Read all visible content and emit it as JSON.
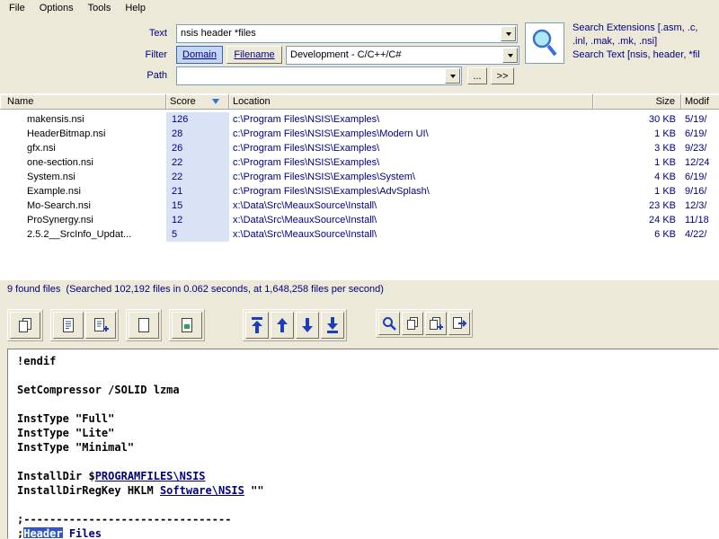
{
  "colors": {
    "window_bg": "#ece9d8",
    "accent": "#316ac5",
    "navy_text": "#000080",
    "score_cell_bg": "#d9e3f5",
    "selection_bg": "#3058c5"
  },
  "menu": {
    "items": [
      "File",
      "Options",
      "Tools",
      "Help"
    ]
  },
  "search": {
    "text_label": "Text",
    "text_value": "nsis header *files",
    "filter_label": "Filter",
    "domain_toggle": "Domain",
    "filename_toggle": "Filename",
    "category_value": "Development - C/C++/C#",
    "path_label": "Path",
    "path_value": "",
    "browse_label": "...",
    "more_label": ">>",
    "info_lines": [
      "Search Extensions [.asm, .c,",
      ".inl, .mak, .mk, .nsi]",
      "Search Text [nsis, header, *fil"
    ]
  },
  "results": {
    "columns": [
      "Name",
      "Score",
      "Location",
      "Size",
      "Modif"
    ],
    "sort_column": "Score",
    "sort_direction": "descending",
    "rows": [
      {
        "name": "makensis.nsi",
        "score": "126",
        "location": "c:\\Program Files\\NSIS\\Examples\\",
        "size": "30 KB",
        "modified": "5/19/"
      },
      {
        "name": "HeaderBitmap.nsi",
        "score": "28",
        "location": "c:\\Program Files\\NSIS\\Examples\\Modern UI\\",
        "size": "1 KB",
        "modified": "6/19/"
      },
      {
        "name": "gfx.nsi",
        "score": "26",
        "location": "c:\\Program Files\\NSIS\\Examples\\",
        "size": "3 KB",
        "modified": "9/23/"
      },
      {
        "name": "one-section.nsi",
        "score": "22",
        "location": "c:\\Program Files\\NSIS\\Examples\\",
        "size": "1 KB",
        "modified": "12/24"
      },
      {
        "name": "System.nsi",
        "score": "22",
        "location": "c:\\Program Files\\NSIS\\Examples\\System\\",
        "size": "4 KB",
        "modified": "6/19/"
      },
      {
        "name": "Example.nsi",
        "score": "21",
        "location": "c:\\Program Files\\NSIS\\Examples\\AdvSplash\\",
        "size": "1 KB",
        "modified": "9/16/"
      },
      {
        "name": "Mo-Search.nsi",
        "score": "15",
        "location": "x:\\Data\\Src\\MeauxSource\\Install\\",
        "size": "23 KB",
        "modified": "12/3/"
      },
      {
        "name": "ProSynergy.nsi",
        "score": "12",
        "location": "x:\\Data\\Src\\MeauxSource\\Install\\",
        "size": "24 KB",
        "modified": "11/18"
      },
      {
        "name": "2.5.2__SrcInfo_Updat...",
        "score": "5",
        "location": "x:\\Data\\Src\\MeauxSource\\Install\\",
        "size": "6 KB",
        "modified": "4/22/"
      }
    ]
  },
  "status": {
    "text": "9 found files  (Searched 102,192 files in 0.062 seconds, at 1,648,258 files per second)"
  },
  "preview": {
    "toolbar_groups": [
      [
        "copy-icon"
      ],
      [
        "doc-lines-icon",
        "doc-add-icon"
      ],
      [
        "doc-blank-icon"
      ],
      [
        "doc-image-icon"
      ],
      [
        "first-match-icon",
        "prev-match-icon",
        "next-match-icon",
        "last-match-icon"
      ],
      [
        "find-icon",
        "copy-small-icon",
        "copy-add-icon",
        "export-icon"
      ]
    ],
    "lines": [
      [
        {
          "t": "!endif"
        }
      ],
      [],
      [
        {
          "t": "SetCompressor /SOLID lzma"
        }
      ],
      [],
      [
        {
          "t": "InstType \"Full\""
        }
      ],
      [
        {
          "t": "InstType \"Lite\""
        }
      ],
      [
        {
          "t": "InstType \"Minimal\""
        }
      ],
      [],
      [
        {
          "t": "InstallDir $"
        },
        {
          "t": "PROGRAMFILES\\NSIS",
          "match": true
        }
      ],
      [
        {
          "t": "InstallDirRegKey HKLM "
        },
        {
          "t": "Software\\NSIS",
          "match": true
        },
        {
          "t": " \"\""
        }
      ],
      [],
      [
        {
          "t": ";--------------------------------"
        }
      ],
      [
        {
          "t": ";"
        },
        {
          "t": "Header",
          "selected": true
        },
        {
          "t": " "
        },
        {
          "t": "Files",
          "match": true
        }
      ]
    ]
  }
}
